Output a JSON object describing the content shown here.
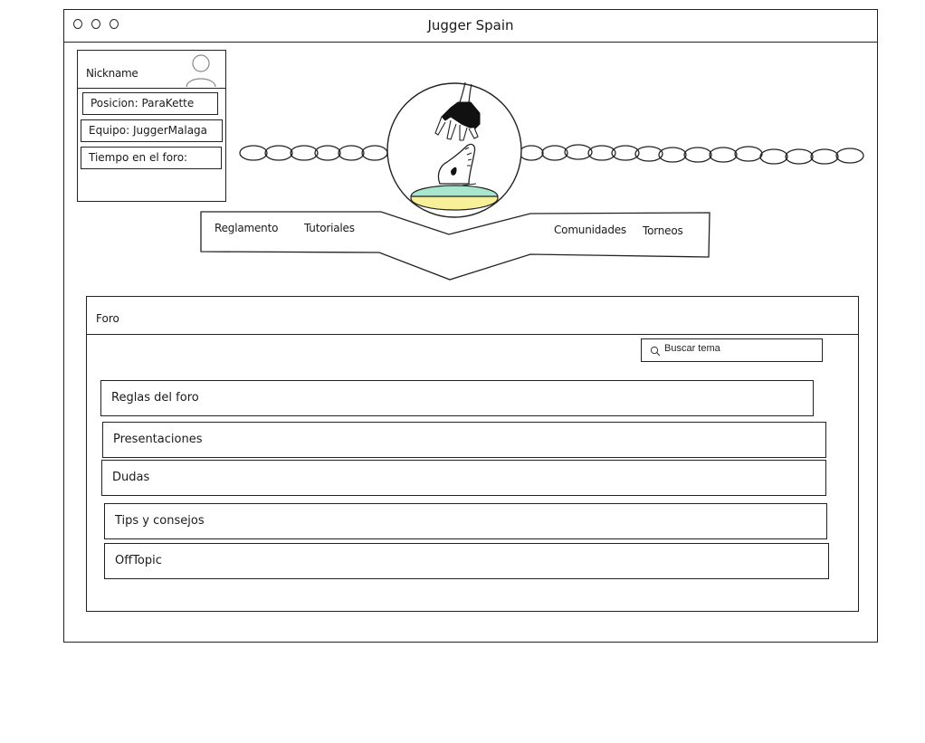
{
  "window": {
    "title": "Jugger Spain"
  },
  "profile": {
    "nickname": "Nickname",
    "position": "Posicion: ParaKette",
    "team": "Equipo: JuggerMalaga",
    "forum_time": "Tiempo en el foro:"
  },
  "nav": {
    "items": [
      {
        "label": "Reglamento"
      },
      {
        "label": "Tutoriales"
      },
      {
        "label": "Comunidades"
      },
      {
        "label": "Torneos"
      }
    ]
  },
  "forum": {
    "title": "Foro",
    "search": {
      "placeholder": "Buscar tema",
      "icon": "search-icon"
    },
    "topics": [
      {
        "label": "Reglas del foro"
      },
      {
        "label": "Presentaciones"
      },
      {
        "label": "Dudas"
      },
      {
        "label": "Tips y consejos"
      },
      {
        "label": "OffTopic"
      }
    ]
  },
  "colors": {
    "ink": "#222222",
    "logo_mint": "#a8e6cf",
    "logo_yellow": "#f7ef9a"
  }
}
